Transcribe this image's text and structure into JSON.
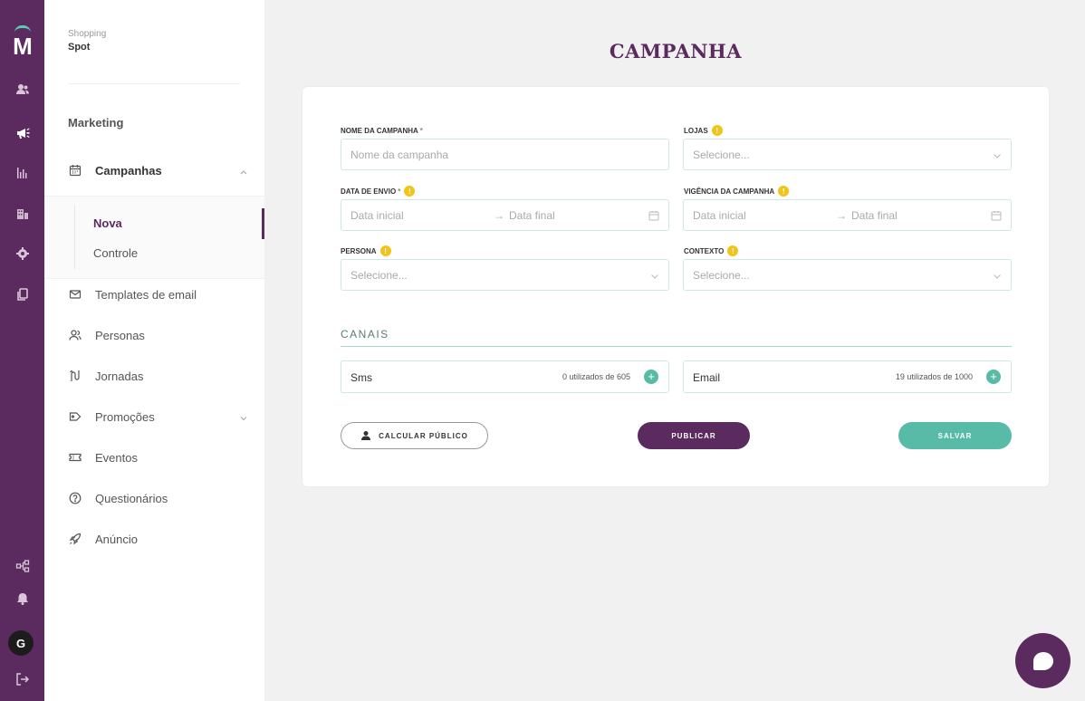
{
  "rail": {
    "logo_letter": "M",
    "avatar_initial": "G",
    "icons": [
      "users-icon",
      "megaphone-icon",
      "bar-chart-icon",
      "building-icon",
      "settings-icon",
      "copy-icon",
      "network-icon",
      "bell-icon",
      "logout-icon"
    ]
  },
  "sidebar": {
    "brand_sub": "Shopping",
    "brand_main": "Spot",
    "section": "Marketing",
    "campaigns_label": "Campanhas",
    "submenu": [
      "Nova",
      "Controle"
    ],
    "items": [
      "Templates de email",
      "Personas",
      "Jornadas",
      "Promoções",
      "Eventos",
      "Questionários",
      "Anúncio"
    ]
  },
  "main": {
    "title": "CAMPANHA",
    "form": {
      "campaign_name_label": "NOME DA CAMPANHA",
      "campaign_name_placeholder": "Nome da campanha",
      "stores_label": "LOJAS",
      "stores_placeholder": "Selecione...",
      "send_date_label": "DATA DE ENVIO",
      "validity_label": "VIGÊNCIA DA CAMPANHA",
      "start_placeholder": "Data inicial",
      "end_placeholder": "Data final",
      "persona_label": "PERSONA",
      "persona_placeholder": "Selecione...",
      "context_label": "CONTEXTO",
      "context_placeholder": "Selecione...",
      "required_mark": "*",
      "info_mark": "!",
      "range_arrow": "→"
    },
    "channels": {
      "title": "CANAIS",
      "items": [
        {
          "name": "Sms",
          "usage": "0 utilizados de 605"
        },
        {
          "name": "Email",
          "usage": "19 utilizados de 1000"
        }
      ],
      "plus": "+"
    },
    "buttons": {
      "calculate": "CALCULAR PÚBLICO",
      "publish": "PUBLICAR",
      "save": "SALVAR"
    }
  },
  "colors": {
    "primary": "#5b2a5e",
    "accent": "#57bba7",
    "info": "#f0c419"
  }
}
